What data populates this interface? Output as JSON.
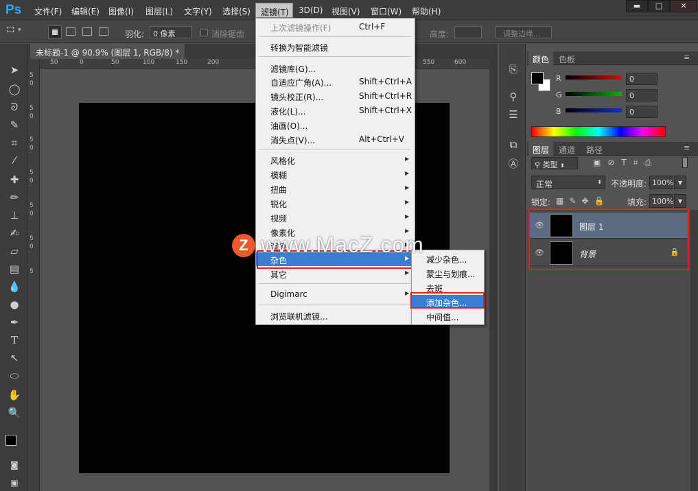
{
  "app": {
    "logo": "Ps"
  },
  "menubar": {
    "items": [
      "文件(F)",
      "编辑(E)",
      "图像(I)",
      "图层(L)",
      "文字(Y)",
      "选择(S)",
      "滤镜(T)",
      "3D(D)",
      "视图(V)",
      "窗口(W)",
      "帮助(H)"
    ],
    "active": "滤镜(T)"
  },
  "window_controls": {
    "minimize": "▬",
    "maximize": "□",
    "close": "✕"
  },
  "options_bar": {
    "feather_label": "羽化:",
    "feather_value": "0 像素",
    "antialias_label": "消除锯齿",
    "height_label": "高度:",
    "refine_edge_button": "调整边缘..."
  },
  "document": {
    "tab_title": "未标题-1 @ 90.9% (图层 1, RGB/8) *",
    "close_glyph": "×",
    "ruler_h_ticks": [
      "50",
      "0",
      "50",
      "100",
      "150",
      "200",
      "550",
      "600"
    ],
    "ruler_v_ticks": [
      "5",
      "0",
      "5",
      "0",
      "5",
      "0",
      "5",
      "0",
      "5",
      "0",
      "5",
      "0",
      "5"
    ]
  },
  "filter_menu": {
    "items": [
      {
        "label": "上次滤镜操作(F)",
        "shortcut": "Ctrl+F",
        "disabled": true
      },
      {
        "label": "转换为智能滤镜"
      },
      {
        "label": "滤镜库(G)..."
      },
      {
        "label": "自适应广角(A)...",
        "shortcut": "Shift+Ctrl+A"
      },
      {
        "label": "镜头校正(R)...",
        "shortcut": "Shift+Ctrl+R"
      },
      {
        "label": "液化(L)...",
        "shortcut": "Shift+Ctrl+X"
      },
      {
        "label": "油画(O)..."
      },
      {
        "label": "消失点(V)...",
        "shortcut": "Alt+Ctrl+V"
      },
      {
        "label": "风格化",
        "submenu": true
      },
      {
        "label": "模糊",
        "submenu": true
      },
      {
        "label": "扭曲",
        "submenu": true
      },
      {
        "label": "锐化",
        "submenu": true
      },
      {
        "label": "视频",
        "submenu": true
      },
      {
        "label": "像素化",
        "submenu": true
      },
      {
        "label": "渲染",
        "submenu": true
      },
      {
        "label": "杂色",
        "submenu": true,
        "highlighted": true
      },
      {
        "label": "其它",
        "submenu": true
      },
      {
        "label": "Digimarc",
        "submenu": true
      },
      {
        "label": "浏览联机滤镜..."
      }
    ]
  },
  "noise_submenu": {
    "items": [
      {
        "label": "减少杂色..."
      },
      {
        "label": "蒙尘与划痕..."
      },
      {
        "label": "去斑"
      },
      {
        "label": "添加杂色...",
        "highlighted": true
      },
      {
        "label": "中间值..."
      }
    ]
  },
  "color_panel": {
    "tabs": [
      "颜色",
      "色板"
    ],
    "channels": [
      {
        "label": "R",
        "value": "0",
        "color": "#d01010"
      },
      {
        "label": "G",
        "value": "0",
        "color": "#10b010"
      },
      {
        "label": "B",
        "value": "0",
        "color": "#1030d0"
      }
    ]
  },
  "layers_panel": {
    "tabs": [
      "图层",
      "通道",
      "路径"
    ],
    "kind_filter": "类型",
    "blend_mode": "正常",
    "opacity_label": "不透明度:",
    "opacity_value": "100%",
    "lock_label": "锁定:",
    "fill_label": "填充:",
    "fill_value": "100%",
    "layers": [
      {
        "name": "图层 1",
        "selected": true
      },
      {
        "name": "背景",
        "locked": true
      }
    ]
  },
  "watermark": {
    "logo_letter": "Z",
    "text": "www.MacZ.com"
  },
  "colors": {
    "accent": "#3a7fcf",
    "highlight_box": "#e02020",
    "panel_bg": "#535353",
    "canvas": "#000000"
  }
}
